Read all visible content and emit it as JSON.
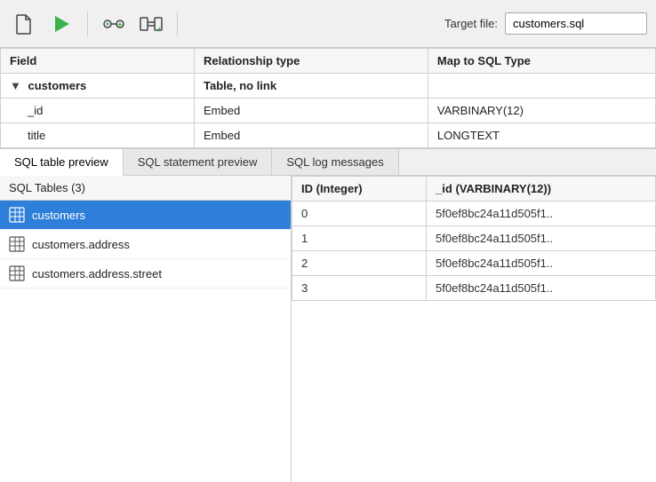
{
  "toolbar": {
    "new_icon": "new-file-icon",
    "run_icon": "run-icon",
    "add_relation_icon": "add-relation-icon",
    "connect_icon": "connect-icon",
    "target_file_label": "Target file:",
    "target_file_value": "customers.sql"
  },
  "schema_table": {
    "headers": [
      "Field",
      "Relationship type",
      "Map to SQL Type"
    ],
    "rows": [
      {
        "field": "customers",
        "indent": 0,
        "chevron": true,
        "rel_type": "Table, no link",
        "sql_type": "",
        "is_parent": true
      },
      {
        "field": "_id",
        "indent": 1,
        "chevron": false,
        "rel_type": "Embed",
        "sql_type": "VARBINARY(12)",
        "is_parent": false
      },
      {
        "field": "title",
        "indent": 1,
        "chevron": false,
        "rel_type": "Embed",
        "sql_type": "LONGTEXT",
        "is_parent": false
      }
    ]
  },
  "tabs": [
    {
      "label": "SQL table preview",
      "active": true
    },
    {
      "label": "SQL statement preview",
      "active": false
    },
    {
      "label": "SQL log messages",
      "active": false
    }
  ],
  "left_panel": {
    "header": "SQL Tables (3)",
    "items": [
      {
        "name": "customers",
        "selected": true
      },
      {
        "name": "customers.address",
        "selected": false
      },
      {
        "name": "customers.address.street",
        "selected": false
      }
    ]
  },
  "right_panel": {
    "headers": [
      "ID (Integer)",
      "_id (VARBINARY(12))"
    ],
    "rows": [
      {
        "id": "0",
        "val": "5f0ef8bc24a11d505f1.."
      },
      {
        "id": "1",
        "val": "5f0ef8bc24a11d505f1.."
      },
      {
        "id": "2",
        "val": "5f0ef8bc24a11d505f1.."
      },
      {
        "id": "3",
        "val": "5f0ef8bc24a11d505f1.."
      }
    ]
  }
}
